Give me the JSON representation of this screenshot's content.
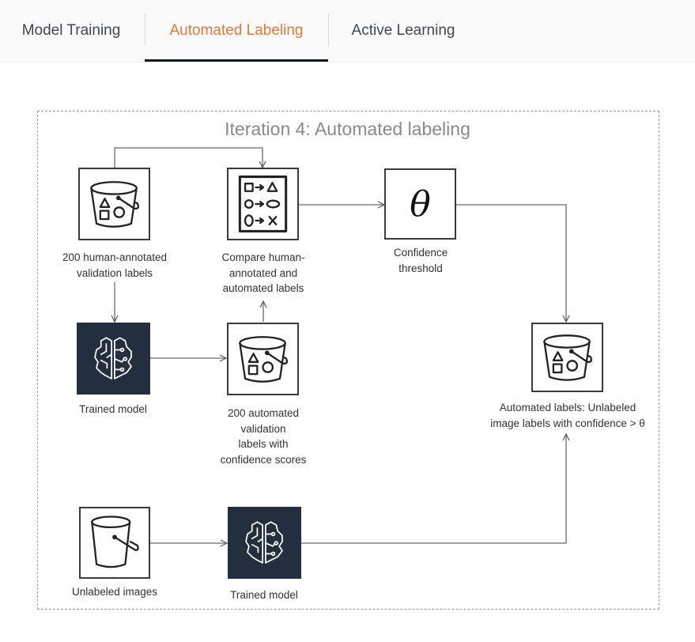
{
  "tabs": [
    {
      "label": "Model Training",
      "active": false
    },
    {
      "label": "Automated Labeling",
      "active": true
    },
    {
      "label": "Active Learning",
      "active": false
    }
  ],
  "accent_color": "#e07b39",
  "diagram": {
    "title": "Iteration 4: Automated labeling",
    "nodes": {
      "human_labels": {
        "icon": "bucket-shapes-icon",
        "label_lines": [
          "200 human-annotated",
          "validation labels"
        ]
      },
      "compare": {
        "icon": "comparison-list-icon",
        "label_lines": [
          "Compare human-",
          "annotated and",
          "automated labels"
        ]
      },
      "threshold": {
        "icon": "theta-icon",
        "symbol": "θ",
        "label_lines": [
          "Confidence",
          "threshold"
        ]
      },
      "trained_model_top": {
        "icon": "brain-icon",
        "label_lines": [
          "Trained model"
        ]
      },
      "auto_validation": {
        "icon": "bucket-shapes-icon",
        "label_lines": [
          "200 automated",
          "validation",
          "labels with",
          "confidence scores"
        ]
      },
      "automated_labels": {
        "icon": "bucket-shapes-icon",
        "label_lines": [
          "Automated labels: Unlabeled",
          "image labels with confidence > θ"
        ]
      },
      "unlabeled_images": {
        "icon": "bucket-icon",
        "label_lines": [
          "Unlabeled images"
        ]
      },
      "trained_model_bottom": {
        "icon": "brain-icon",
        "label_lines": [
          "Trained model"
        ]
      }
    }
  }
}
